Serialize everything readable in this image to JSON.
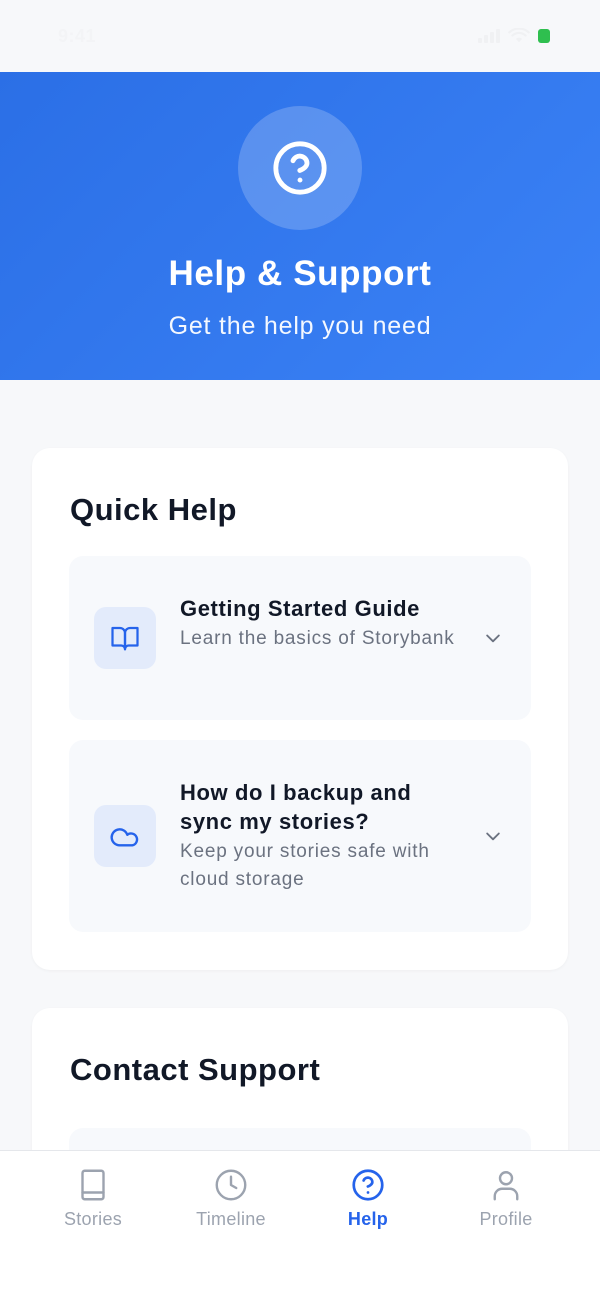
{
  "status_bar": {
    "time": "9:41"
  },
  "header": {
    "title": "Help & Support",
    "subtitle": "Get the help you need",
    "icon": "help-circle-icon",
    "gradient": [
      "#2b6fe6",
      "#3b82f6"
    ]
  },
  "quick_help": {
    "title": "Quick Help",
    "items": [
      {
        "icon": "book-open-icon",
        "title": "Getting Started Guide",
        "description": "Learn the basics of Storybank",
        "expanded": false
      },
      {
        "icon": "cloud-icon",
        "title": "How do I backup and sync my stories?",
        "description": "Keep your stories safe with cloud storage",
        "expanded": false
      }
    ]
  },
  "contact_support": {
    "title": "Contact Support"
  },
  "tab_bar": {
    "active": "Help",
    "active_color": "#2563eb",
    "inactive_color": "#9ca3af",
    "tabs": [
      {
        "label": "Stories",
        "icon": "book-icon"
      },
      {
        "label": "Timeline",
        "icon": "clock-icon"
      },
      {
        "label": "Help",
        "icon": "help-circle-icon"
      },
      {
        "label": "Profile",
        "icon": "user-icon"
      }
    ]
  }
}
